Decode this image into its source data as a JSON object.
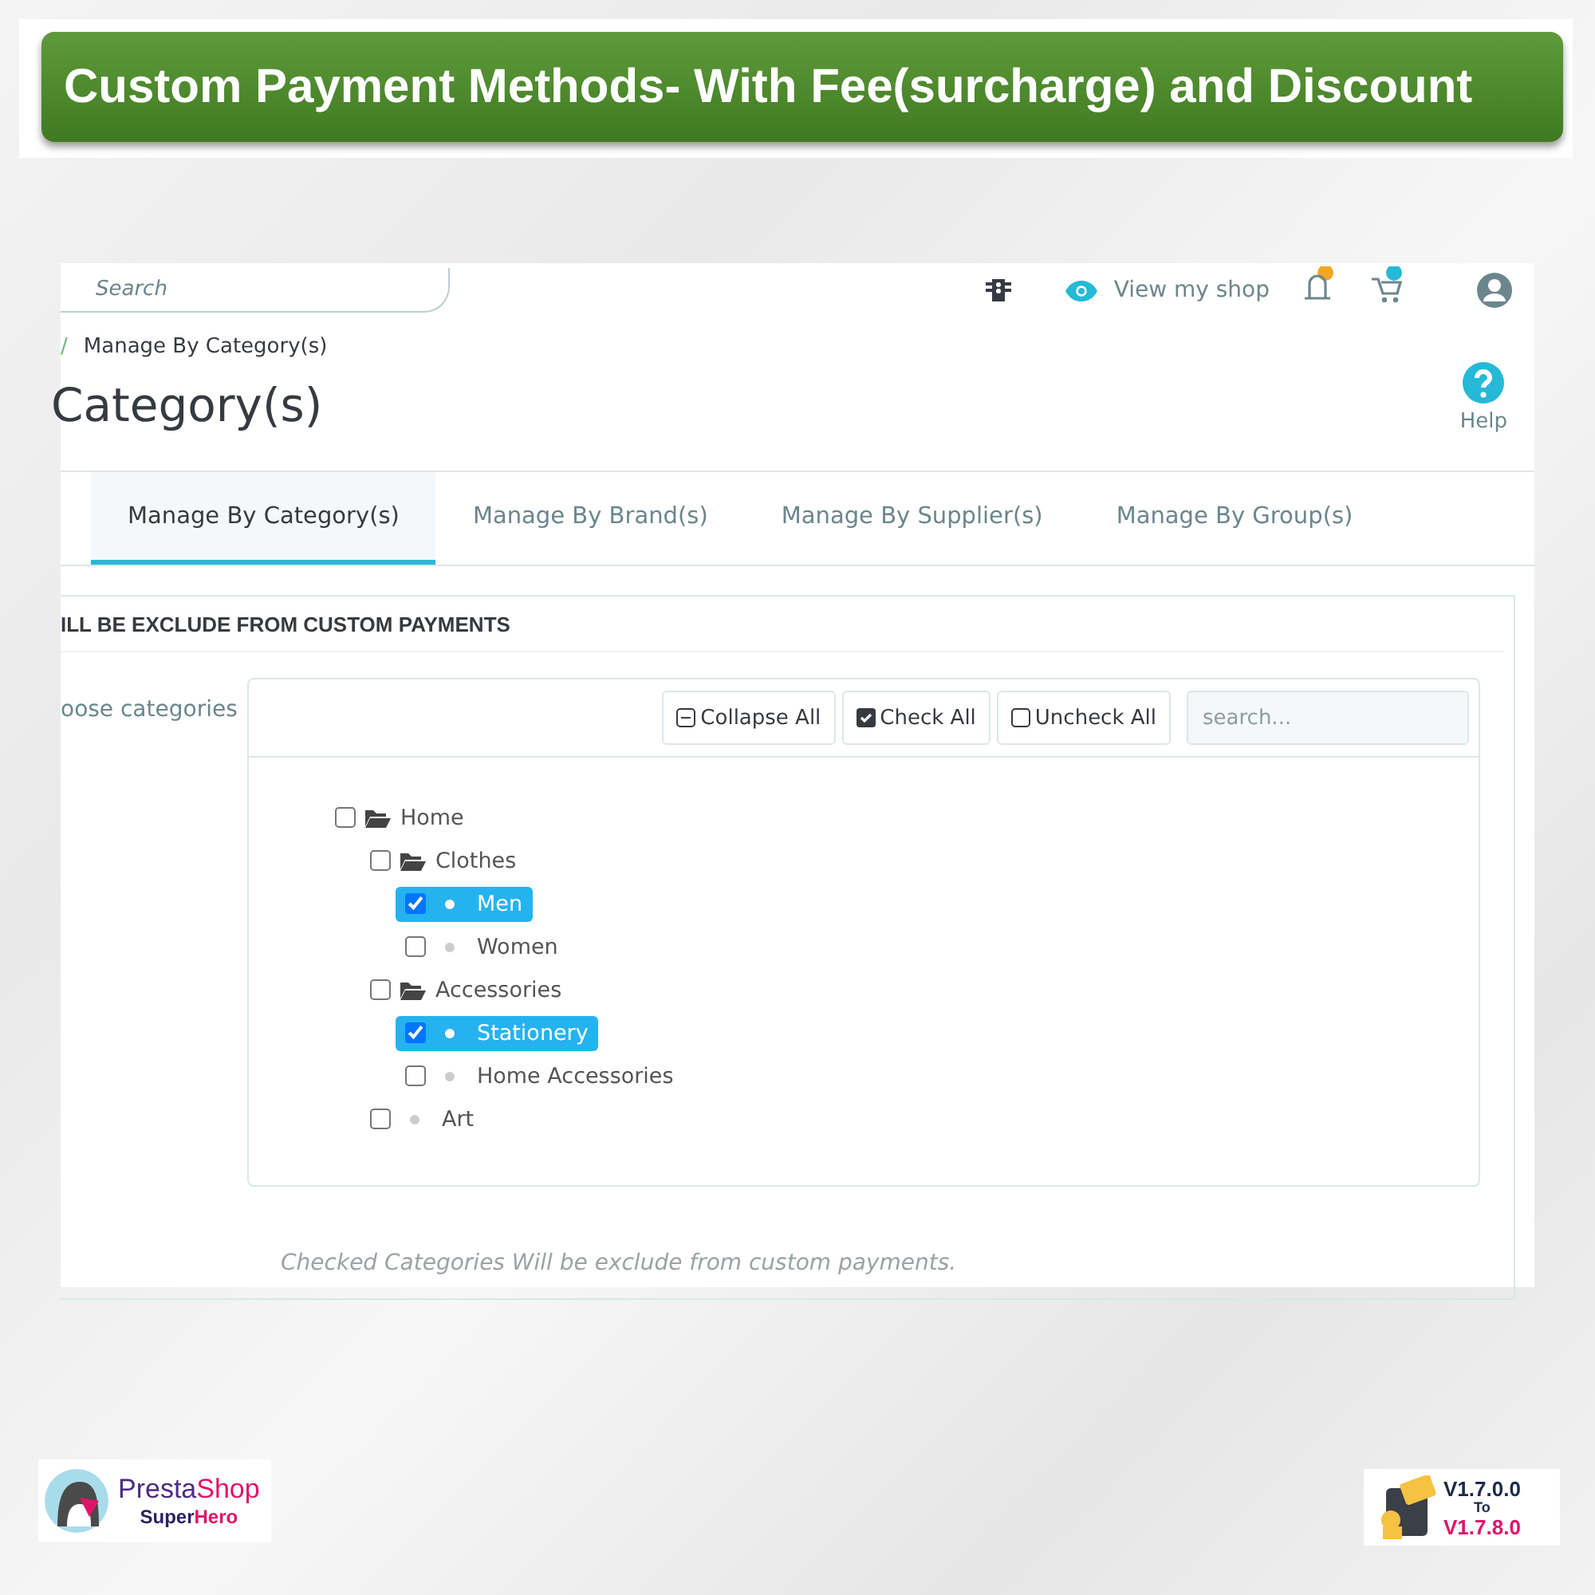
{
  "banner": {
    "title": "Custom Payment Methods- With Fee(surcharge) and Discount"
  },
  "topbar": {
    "search": {
      "placeholder": "Search"
    },
    "view_shop": "View my shop"
  },
  "breadcrumb": {
    "separator": "/",
    "current": "Manage By Category(s)"
  },
  "page_title": "Category(s)",
  "help": "Help",
  "tabs": [
    {
      "label": "Manage By Category(s)",
      "selected": true
    },
    {
      "label": "Manage By Brand(s)",
      "selected": false
    },
    {
      "label": "Manage By Supplier(s)",
      "selected": false
    },
    {
      "label": "Manage By Group(s)",
      "selected": false
    }
  ],
  "card": {
    "heading": "ILL BE EXCLUDE FROM CUSTOM PAYMENTS",
    "field_label": "oose categories",
    "toolbar": [
      {
        "kind": "collapse",
        "label": "Collapse All"
      },
      {
        "kind": "check",
        "label": "Check All"
      },
      {
        "kind": "uncheck",
        "label": "Uncheck All"
      }
    ],
    "tree_search": {
      "placeholder": "search..."
    },
    "tree": [
      {
        "label": "Home",
        "kind": "folder",
        "checked": false,
        "children": [
          {
            "label": "Clothes",
            "kind": "folder",
            "checked": false,
            "children": [
              {
                "label": "Men",
                "kind": "leaf",
                "checked": true
              },
              {
                "label": "Women",
                "kind": "leaf",
                "checked": false
              }
            ]
          },
          {
            "label": "Accessories",
            "kind": "folder",
            "checked": false,
            "children": [
              {
                "label": "Stationery",
                "kind": "leaf",
                "checked": true
              },
              {
                "label": "Home Accessories",
                "kind": "leaf",
                "checked": false
              }
            ]
          },
          {
            "label": "Art",
            "kind": "leaf",
            "checked": false
          }
        ]
      }
    ],
    "hint": "Checked Categories Will be exclude from custom payments."
  },
  "logo": {
    "brand": [
      "Presta",
      "Shop"
    ],
    "tagline": [
      "Super",
      "Hero"
    ]
  },
  "version_badge": {
    "from": "V1.7.0.0",
    "to_word": "To",
    "to": "V1.7.8.0"
  }
}
